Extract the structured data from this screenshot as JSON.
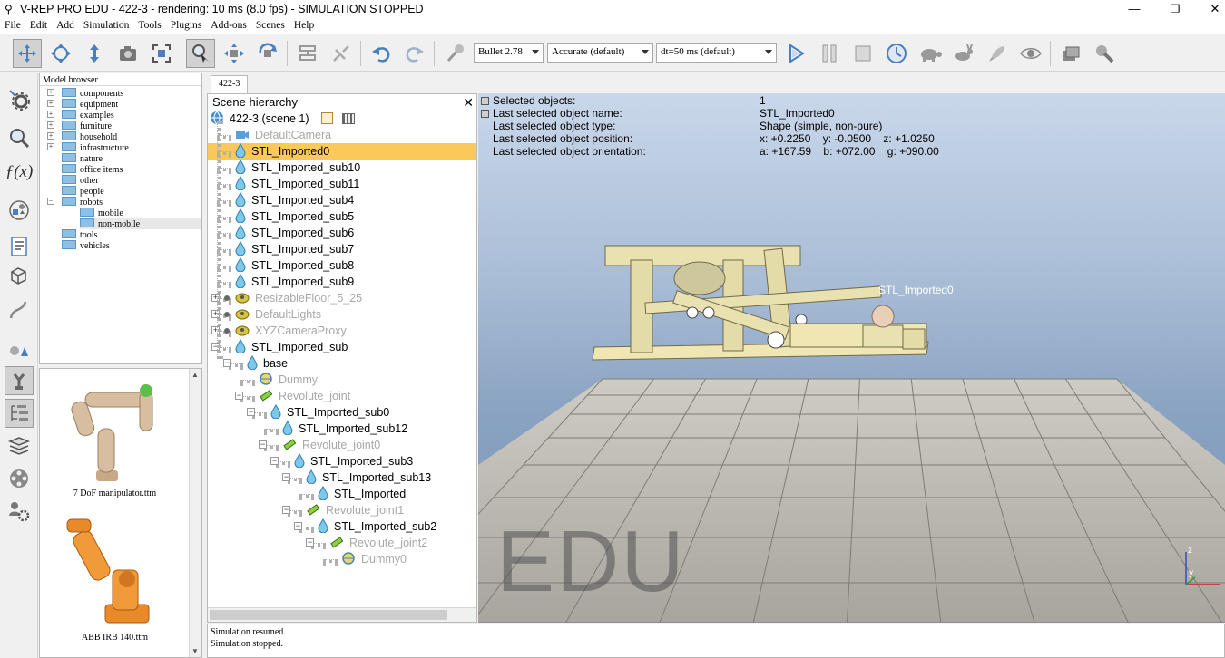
{
  "window": {
    "title": "V-REP PRO EDU - 422-3 - rendering: 10 ms (8.0 fps) - SIMULATION STOPPED",
    "minimize": "—",
    "restore": "❐",
    "close": "✕"
  },
  "menu": [
    "File",
    "Edit",
    "Add",
    "Simulation",
    "Tools",
    "Plugins",
    "Add-ons",
    "Scenes",
    "Help"
  ],
  "toolbar": {
    "physics_engine": "Bullet 2.78",
    "accuracy": "Accurate (default)",
    "timestep": "dt=50 ms (default)"
  },
  "scene_tab": "422-3",
  "model_browser": {
    "title": "Model browser",
    "items": [
      {
        "label": "components",
        "expandable": true
      },
      {
        "label": "equipment",
        "expandable": true
      },
      {
        "label": "examples",
        "expandable": true
      },
      {
        "label": "furniture",
        "expandable": true
      },
      {
        "label": "household",
        "expandable": true
      },
      {
        "label": "infrastructure",
        "expandable": true
      },
      {
        "label": "nature",
        "expandable": false
      },
      {
        "label": "office items",
        "expandable": false
      },
      {
        "label": "other",
        "expandable": false
      },
      {
        "label": "people",
        "expandable": false
      },
      {
        "label": "robots",
        "expandable": true
      },
      {
        "label": "mobile",
        "expandable": false
      },
      {
        "label": "non-mobile",
        "expandable": false
      },
      {
        "label": "tools",
        "expandable": false
      },
      {
        "label": "vehicles",
        "expandable": false
      }
    ]
  },
  "thumbnails": [
    {
      "caption": "7 DoF manipulator.ttm"
    },
    {
      "caption": "ABB IRB 140.ttm"
    }
  ],
  "scene_hierarchy": {
    "title": "Scene hierarchy",
    "root": "422-3 (scene 1)",
    "rows": [
      {
        "label": "DefaultCamera",
        "icon": "camera-icon",
        "dim": true
      },
      {
        "label": "STL_Imported0",
        "icon": "shape-icon",
        "selected": true
      },
      {
        "label": "STL_Imported_sub10",
        "icon": "shape-icon"
      },
      {
        "label": "STL_Imported_sub11",
        "icon": "shape-icon"
      },
      {
        "label": "STL_Imported_sub4",
        "icon": "shape-icon"
      },
      {
        "label": "STL_Imported_sub5",
        "icon": "shape-icon"
      },
      {
        "label": "STL_Imported_sub6",
        "icon": "shape-icon"
      },
      {
        "label": "STL_Imported_sub7",
        "icon": "shape-icon"
      },
      {
        "label": "STL_Imported_sub8",
        "icon": "shape-icon"
      },
      {
        "label": "STL_Imported_sub9",
        "icon": "shape-icon"
      },
      {
        "label": "ResizableFloor_5_25",
        "icon": "model-icon",
        "dim": true
      },
      {
        "label": "DefaultLights",
        "icon": "model-icon",
        "dim": true
      },
      {
        "label": "XYZCameraProxy",
        "icon": "model-icon",
        "dim": true
      },
      {
        "label": "STL_Imported_sub",
        "icon": "shape-icon"
      },
      {
        "label": "base",
        "icon": "shape-icon"
      },
      {
        "label": "Dummy",
        "icon": "dummy-icon",
        "dim": true
      },
      {
        "label": "Revolute_joint",
        "icon": "joint-icon",
        "dim": true
      },
      {
        "label": "STL_Imported_sub0",
        "icon": "shape-icon"
      },
      {
        "label": "STL_Imported_sub12",
        "icon": "shape-icon"
      },
      {
        "label": "Revolute_joint0",
        "icon": "joint-icon",
        "dim": true
      },
      {
        "label": "STL_Imported_sub3",
        "icon": "shape-icon"
      },
      {
        "label": "STL_Imported_sub13",
        "icon": "shape-icon"
      },
      {
        "label": "STL_Imported",
        "icon": "shape-icon"
      },
      {
        "label": "Revolute_joint1",
        "icon": "joint-icon",
        "dim": true
      },
      {
        "label": "STL_Imported_sub2",
        "icon": "shape-icon"
      },
      {
        "label": "Revolute_joint2",
        "icon": "joint-icon",
        "dim": true
      },
      {
        "label": "Dummy0",
        "icon": "dummy-icon",
        "dim": true
      }
    ]
  },
  "info": {
    "labels": [
      "Selected objects:",
      "Last selected object name:",
      "Last selected object type:",
      "Last selected object position:",
      "Last selected object orientation:"
    ],
    "values": [
      "1",
      "STL_Imported0",
      "Shape (simple, non-pure)",
      "x: +0.2250    y: -0.0500    z: +1.0250",
      "a: +167.59    b: +072.00    g: +090.00"
    ]
  },
  "viewport": {
    "object_label": "STL_Imported0",
    "watermark": "EDU",
    "axis_z": "z",
    "axis_y": "y"
  },
  "console": [
    "Simulation resumed.",
    "Simulation stopped."
  ]
}
